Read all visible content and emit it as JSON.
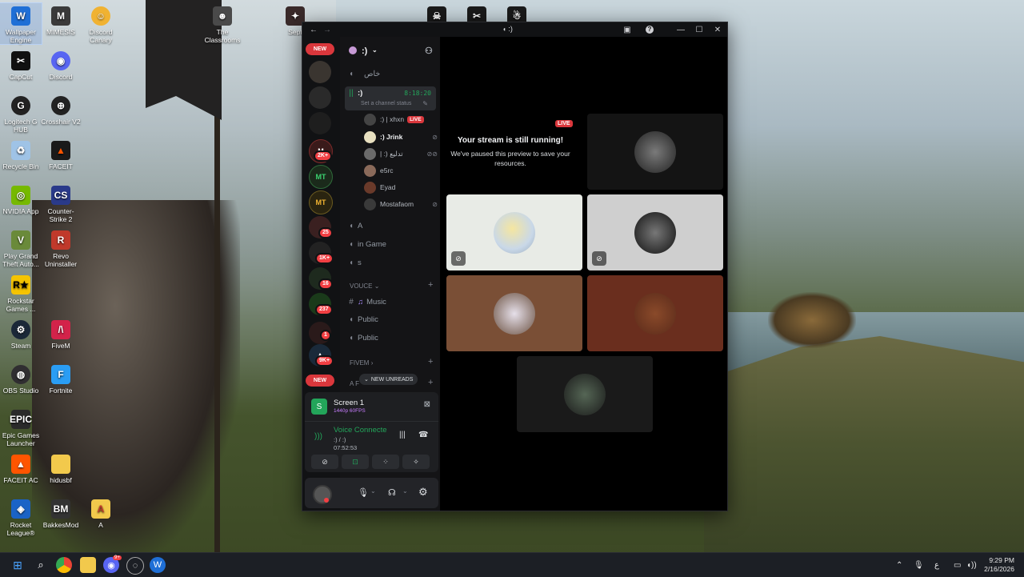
{
  "desktop": {
    "icons": [
      {
        "label": "Wallpaper Engine",
        "icon": "wallpaper-engine-icon",
        "color": "#1f6fd6"
      },
      {
        "label": "MIMESIS",
        "icon": "mimesis-icon",
        "color": "#3a3a3a"
      },
      {
        "label": "Discord Canary",
        "icon": "discord-canary-icon",
        "color": "#f0b232"
      },
      {
        "label": "The Classrooms",
        "icon": "classrooms-icon",
        "color": "#4a4a4a"
      },
      {
        "label": "Sept",
        "icon": "sept-icon",
        "color": "#3a2a2a"
      },
      {
        "label": "CapCut",
        "icon": "capcut-icon",
        "color": "#111111"
      },
      {
        "label": "Discord",
        "icon": "discord-icon",
        "color": "#5865f2"
      },
      {
        "label": "Logitech G HUB",
        "icon": "logitech-icon",
        "color": "#222222"
      },
      {
        "label": "Crosshair V2",
        "icon": "crosshair-icon",
        "color": "#222222"
      },
      {
        "label": "Recycle Bin",
        "icon": "recycle-bin-icon",
        "color": "#9fc3e6"
      },
      {
        "label": "FACEIT",
        "icon": "faceit-icon",
        "color": "#1a1a1a"
      },
      {
        "label": "NVIDIA App",
        "icon": "nvidia-icon",
        "color": "#76b900"
      },
      {
        "label": "Counter-Strike 2",
        "icon": "cs2-icon",
        "color": "#2a3a8a"
      },
      {
        "label": "Play Grand Theft Auto...",
        "icon": "gta-icon",
        "color": "#6a8a3a"
      },
      {
        "label": "Revo Uninstaller",
        "icon": "revo-icon",
        "color": "#c0392b"
      },
      {
        "label": "Rockstar Games ...",
        "icon": "rockstar-icon",
        "color": "#f5c400"
      },
      {
        "label": "Steam",
        "icon": "steam-icon",
        "color": "#1b2838"
      },
      {
        "label": "FiveM",
        "icon": "fivem-icon",
        "color": "#d3234a"
      },
      {
        "label": "OBS Studio",
        "icon": "obs-icon",
        "color": "#302e31"
      },
      {
        "label": "Fortnite",
        "icon": "fortnite-icon",
        "color": "#2a9df4"
      },
      {
        "label": "Epic Games Launcher",
        "icon": "epic-icon",
        "color": "#2a2a2a"
      },
      {
        "label": "FACEIT AC",
        "icon": "faceit-ac-icon",
        "color": "#ff5500"
      },
      {
        "label": "hidusbf",
        "icon": "folder-icon",
        "color": "#f2c94c"
      },
      {
        "label": "Rocket League®",
        "icon": "rocket-league-icon",
        "color": "#1a63c6"
      },
      {
        "label": "BakkesMod",
        "icon": "bakkesmod-icon",
        "color": "#333333"
      },
      {
        "label": "A",
        "icon": "file-icon",
        "color": "#f2c94c"
      }
    ]
  },
  "window": {
    "title": ":)",
    "servers": {
      "top_pill": "NEW",
      "bottom_pill": "NEW",
      "badges": [
        "2K+",
        "25",
        "1K+",
        "16",
        "237",
        "1",
        "9K+"
      ],
      "labels": [
        "MT",
        "MT"
      ]
    },
    "guild": {
      "name": ":)"
    },
    "channels": {
      "private": "خاص",
      "voice_active": {
        "name": ":)",
        "timer": "8:18:20",
        "status": "Set a channel status"
      },
      "members": [
        {
          "name": ":) | xhxn",
          "live": "LIVE"
        },
        {
          "name": ":) Jrink"
        },
        {
          "name": "| :) تدليع"
        },
        {
          "name": "e5rc"
        },
        {
          "name": "Eyad"
        },
        {
          "name": "Mostafaom"
        }
      ],
      "voice_list": [
        {
          "name": "A"
        },
        {
          "name": "in Game"
        },
        {
          "name": "s"
        }
      ],
      "cat_voice": "VOUCE",
      "music": "Music",
      "public_1": "Public",
      "public_2": "Public",
      "cat_fivem": "FIVEM",
      "cat_af": "A F",
      "new_unreads": "NEW UNREADS"
    },
    "stream_panel": {
      "title": "Screen 1",
      "quality": "1440p 60FPS",
      "voice_status": "Voice Connecte",
      "channel": ":) / :)",
      "timer": "07:52:53"
    },
    "stage": {
      "live_badge": "LIVE",
      "paused_title": "Your stream is still running!",
      "paused_body": "We've paused this preview to save your resources."
    }
  },
  "taskbar": {
    "discord_badge": "9+",
    "language": "ع",
    "time": "9:29 PM",
    "date": "2/16/2026"
  },
  "colors": {
    "discord_bg": "#111214",
    "live_red": "#da373c",
    "voice_green": "#23a55a"
  }
}
